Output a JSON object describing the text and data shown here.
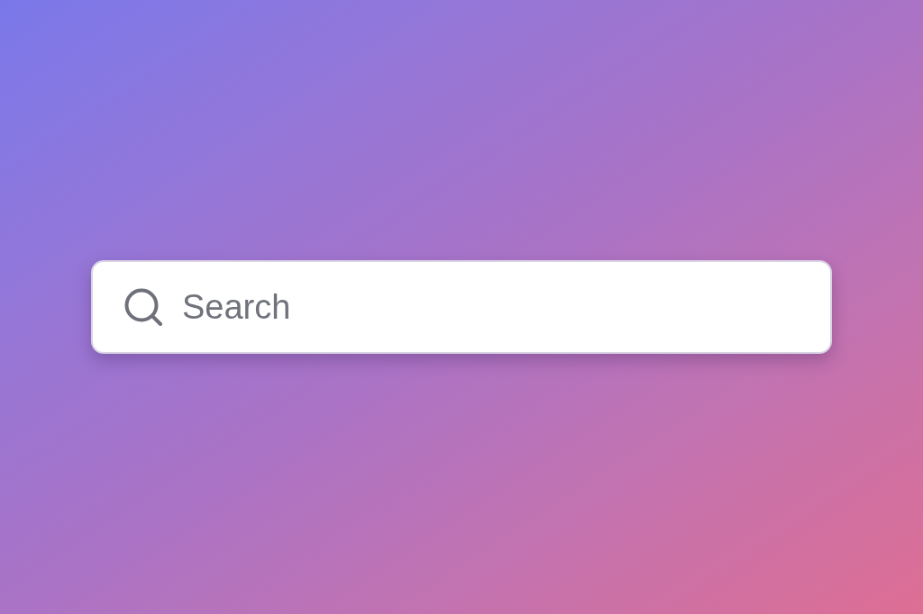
{
  "search": {
    "placeholder": "Search"
  }
}
